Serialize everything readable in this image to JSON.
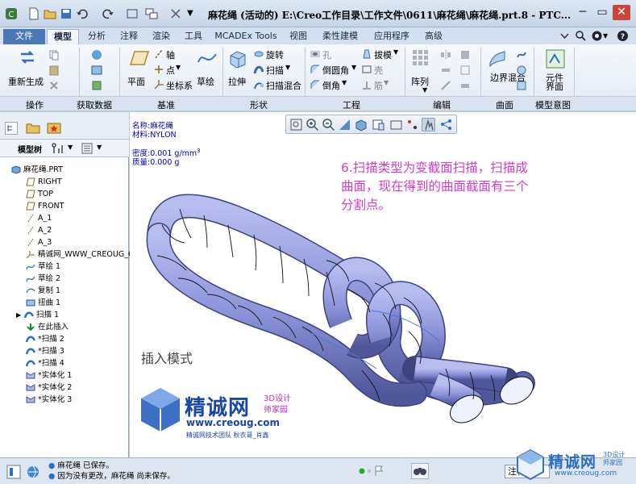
{
  "window": {
    "title": "麻花绳 (活动的) E:\\Creo工作目录\\工作文件\\0611\\麻花绳\\麻花绳.prt.8 - PTC...",
    "min": "─",
    "max": "▭",
    "close": "✕"
  },
  "tabs": [
    "文件",
    "模型",
    "分析",
    "注释",
    "渲染",
    "工具",
    "MCADEx Tools",
    "视图",
    "柔性建模",
    "应用程序",
    "高级"
  ],
  "ribbon": {
    "regenerate": "重新生成",
    "plane": "平面",
    "axis": "轴",
    "point": "点",
    "csys": "坐标系",
    "sketch": "草绘",
    "extrude": "拉伸",
    "revolve": "旋转",
    "sweep": "扫描",
    "swept_blend": "扫描混合",
    "hole": "孔",
    "round": "倒圆角",
    "chamfer": "倒角",
    "draft": "拔模",
    "shell": "壳",
    "rib": "筋",
    "pattern": "阵列",
    "boundary_blend": "边界混合",
    "style": "样式",
    "component_interface": "元件界面"
  },
  "groups": [
    "操作",
    "获取数据",
    "基准",
    "形状",
    "工程",
    "编辑",
    "曲面",
    "模型意图"
  ],
  "model_tree": {
    "header": "模型树",
    "items": [
      "麻花绳.PRT",
      "RIGHT",
      "TOP",
      "FRONT",
      "A_1",
      "A_2",
      "A_3",
      "精诚网_WWW_CREOUG_COM",
      "草绘 1",
      "草绘 2",
      "复制 1",
      "扭曲 1",
      "扫描 1",
      "在此插入",
      "*扫描 2",
      "*扫描 3",
      "*扫描 4",
      "*实体化 1",
      "*实体化 2",
      "*实体化 3"
    ]
  },
  "part_info": {
    "name": "名称:麻花绳",
    "material": "材料:NYLON",
    "density": "密度:0.001 g/mm",
    "density_exp": "3",
    "mass": "质量:0.000 g"
  },
  "annotation": {
    "line1": "6.扫描类型为变截面扫描，扫描成",
    "line2": "曲面，现在得到的曲面截面有三个",
    "line3": "分割点。",
    "color": "#d63cc8"
  },
  "insert_mode": "插入模式",
  "watermark": {
    "brand": "精诚网",
    "tag1": "3D设计",
    "tag2": "师家园",
    "url": "www.creoug.com",
    "slogan": "精诚网技术团队 秋衣哥_肖鑫"
  },
  "status": {
    "line1": "麻花绳 已保存。",
    "line2": "因为没有更改，麻花绳 尚未保存。",
    "filter": "注释"
  },
  "corner_logo": {
    "brand": "精诚网",
    "tag1": "3D设计",
    "tag2": "师家园",
    "url": "www.creoug.com"
  },
  "colors": {
    "rope": "#8a93d8",
    "accent": "#1a46a8"
  }
}
